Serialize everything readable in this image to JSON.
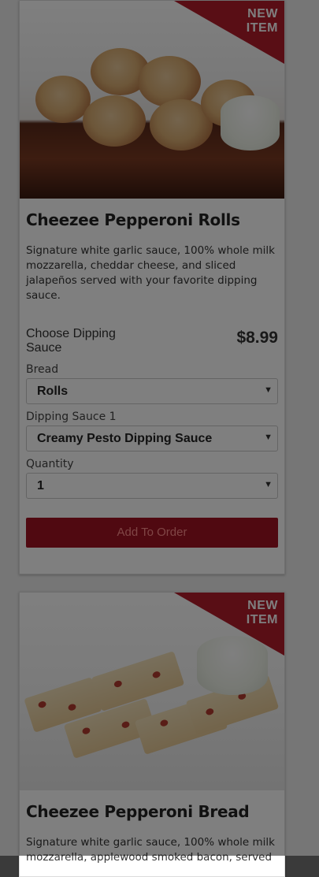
{
  "cards": [
    {
      "badge": "NEW ITEM",
      "title": "Cheezee Pepperoni Rolls",
      "description": "Signature white garlic sauce, 100% whole milk mozzarella, cheddar cheese, and sliced jalapeños served with your favorite dipping sauce.",
      "choose_label": "Choose Dipping Sauce",
      "price": "$8.99",
      "fields": [
        {
          "label": "Bread",
          "value": "Rolls"
        },
        {
          "label": "Dipping Sauce 1",
          "value": "Creamy Pesto Dipping Sauce"
        },
        {
          "label": "Quantity",
          "value": "1"
        }
      ],
      "button": "Add To Order"
    },
    {
      "badge": "NEW ITEM",
      "title": "Cheezee Pepperoni Bread",
      "description": "Signature white garlic sauce, 100% whole milk mozzarella, applewood smoked bacon, served"
    }
  ],
  "colors": {
    "brand_red": "#b21d2b",
    "button_red": "#a11323",
    "overlay": "rgba(0,0,0,0.5)"
  },
  "icons": {
    "select_arrow": "chevron-down-icon"
  }
}
